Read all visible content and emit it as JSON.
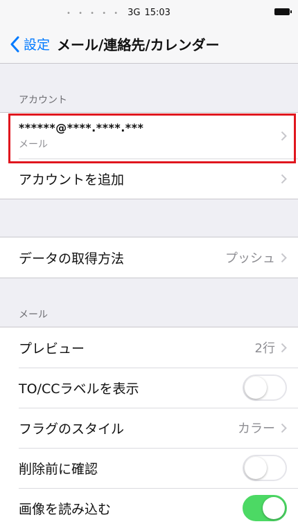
{
  "status_bar": {
    "dots": "• • • • •",
    "network": "3G",
    "time": "15:03"
  },
  "nav": {
    "back_label": "設定",
    "title": "メール/連絡先/カレンダー"
  },
  "accounts_section": {
    "header": "アカウント",
    "account": {
      "email": "******@****.****.***",
      "type": "メール"
    },
    "add_account_label": "アカウントを追加"
  },
  "fetch": {
    "label": "データの取得方法",
    "value": "プッシュ"
  },
  "mail_section": {
    "header": "メール",
    "preview": {
      "label": "プレビュー",
      "value": "2行"
    },
    "tocc": {
      "label": "TO/CCラベルを表示",
      "on": false
    },
    "flag_style": {
      "label": "フラグのスタイル",
      "value": "カラー"
    },
    "ask_before_delete": {
      "label": "削除前に確認",
      "on": false
    },
    "load_images": {
      "label": "画像を読み込む",
      "on": true
    }
  },
  "colors": {
    "accent": "#007aff",
    "switch_on": "#4cd964",
    "highlight": "#e0161e"
  }
}
